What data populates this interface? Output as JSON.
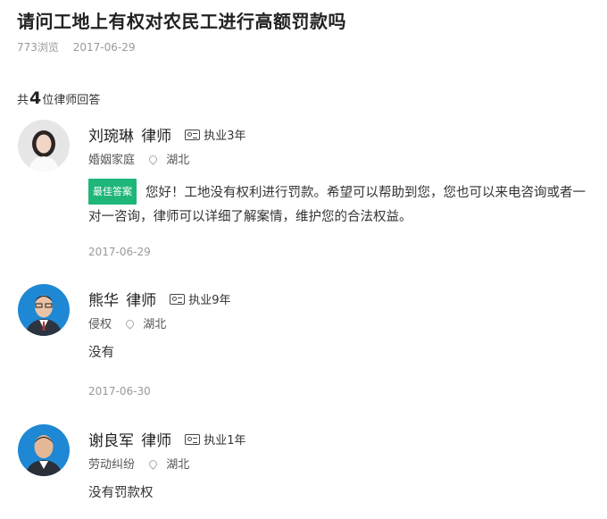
{
  "question": {
    "title": "请问工地上有权对农民工进行高额罚款吗",
    "views": "773浏览",
    "date": "2017-06-29"
  },
  "answers_header": {
    "prefix": "共",
    "count": "4",
    "suffix": "位律师回答"
  },
  "answers": [
    {
      "name": "刘琬琳",
      "title": "律师",
      "license_icon": "license-card-icon",
      "practice": "执业3年",
      "specialty": "婚姻家庭",
      "location": "湖北",
      "best_badge": "最佳答案",
      "content": "您好！工地没有权利进行罚款。希望可以帮助到您，您也可以来电咨询或者一对一咨询，律师可以详细了解案情，维护您的合法权益。",
      "date": "2017-06-29"
    },
    {
      "name": "熊华",
      "title": "律师",
      "license_icon": "license-card-icon",
      "practice": "执业9年",
      "specialty": "侵权",
      "location": "湖北",
      "content": "没有",
      "date": "2017-06-30"
    },
    {
      "name": "谢良军",
      "title": "律师",
      "license_icon": "license-card-icon",
      "practice": "执业1年",
      "specialty": "劳动纠纷",
      "location": "湖北",
      "content": "没有罚款权"
    }
  ],
  "colors": {
    "best_badge": "#1fb67a",
    "avatar_blue": "#1e88d4",
    "muted": "#999999"
  }
}
